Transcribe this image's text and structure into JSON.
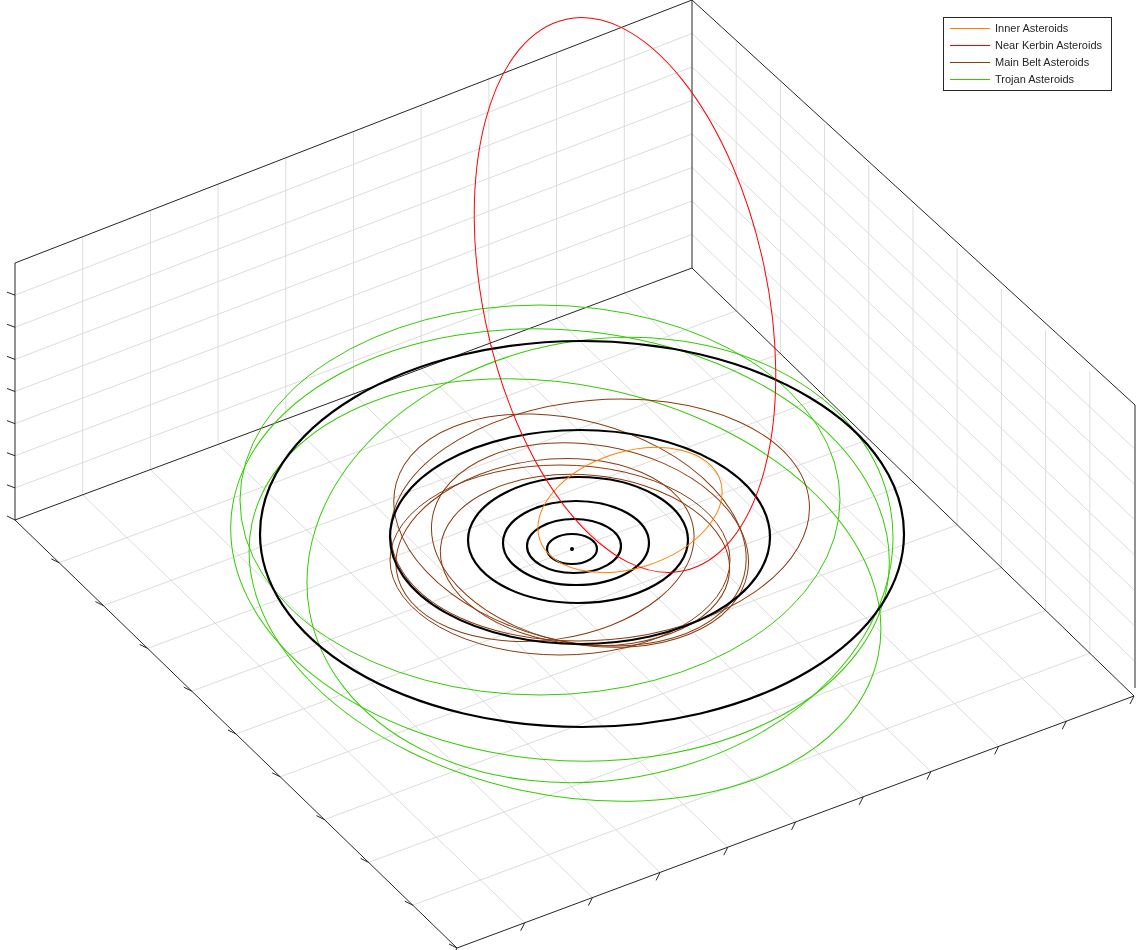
{
  "legend": {
    "items": [
      {
        "label": "Inner Asteroids",
        "color": "#ff8000"
      },
      {
        "label": "Near Kerbin Asteroids",
        "color": "#ff0000"
      },
      {
        "label": "Main Belt Asteroids",
        "color": "#8b3a0e"
      },
      {
        "label": "Trojan Asteroids",
        "color": "#33cc00"
      }
    ]
  }
}
